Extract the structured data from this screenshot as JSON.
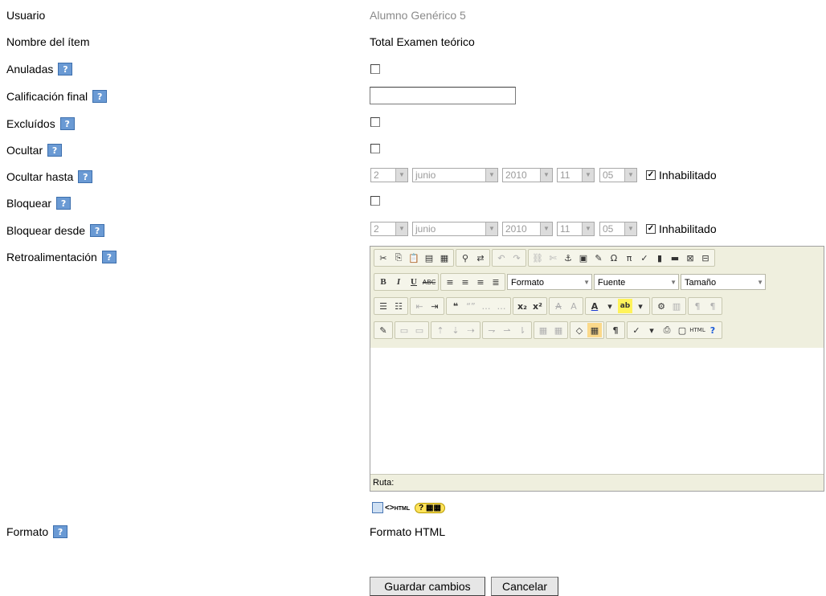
{
  "rows": {
    "usuario": {
      "label": "Usuario",
      "value": "Alumno Genérico 5"
    },
    "nombre_item": {
      "label": "Nombre del ítem",
      "value": "Total Examen teórico"
    },
    "anuladas": {
      "label": "Anuladas"
    },
    "calificacion_final": {
      "label": "Calificación final",
      "value": ""
    },
    "excluidos": {
      "label": "Excluídos"
    },
    "ocultar": {
      "label": "Ocultar"
    },
    "ocultar_hasta": {
      "label": "Ocultar hasta",
      "day": "2",
      "month": "junio",
      "year": "2010",
      "hour": "11",
      "minute": "05",
      "disabled_label": "Inhabilitado"
    },
    "bloquear": {
      "label": "Bloquear"
    },
    "bloquear_desde": {
      "label": "Bloquear desde",
      "day": "2",
      "month": "junio",
      "year": "2010",
      "hour": "11",
      "minute": "05",
      "disabled_label": "Inhabilitado"
    },
    "retroalimentacion": {
      "label": "Retroalimentación"
    },
    "formato": {
      "label": "Formato",
      "value": "Formato HTML"
    }
  },
  "help_icon": "?",
  "editor": {
    "format_select": "Formato",
    "font_select": "Fuente",
    "size_select": "Tamaño",
    "path_label": "Ruta:",
    "html_badge": "HTML"
  },
  "buttons": {
    "save": "Guardar cambios",
    "cancel": "Cancelar"
  },
  "colors": {
    "help_icon": "#6a9ad4",
    "toolbar_bg": "#efefde"
  }
}
